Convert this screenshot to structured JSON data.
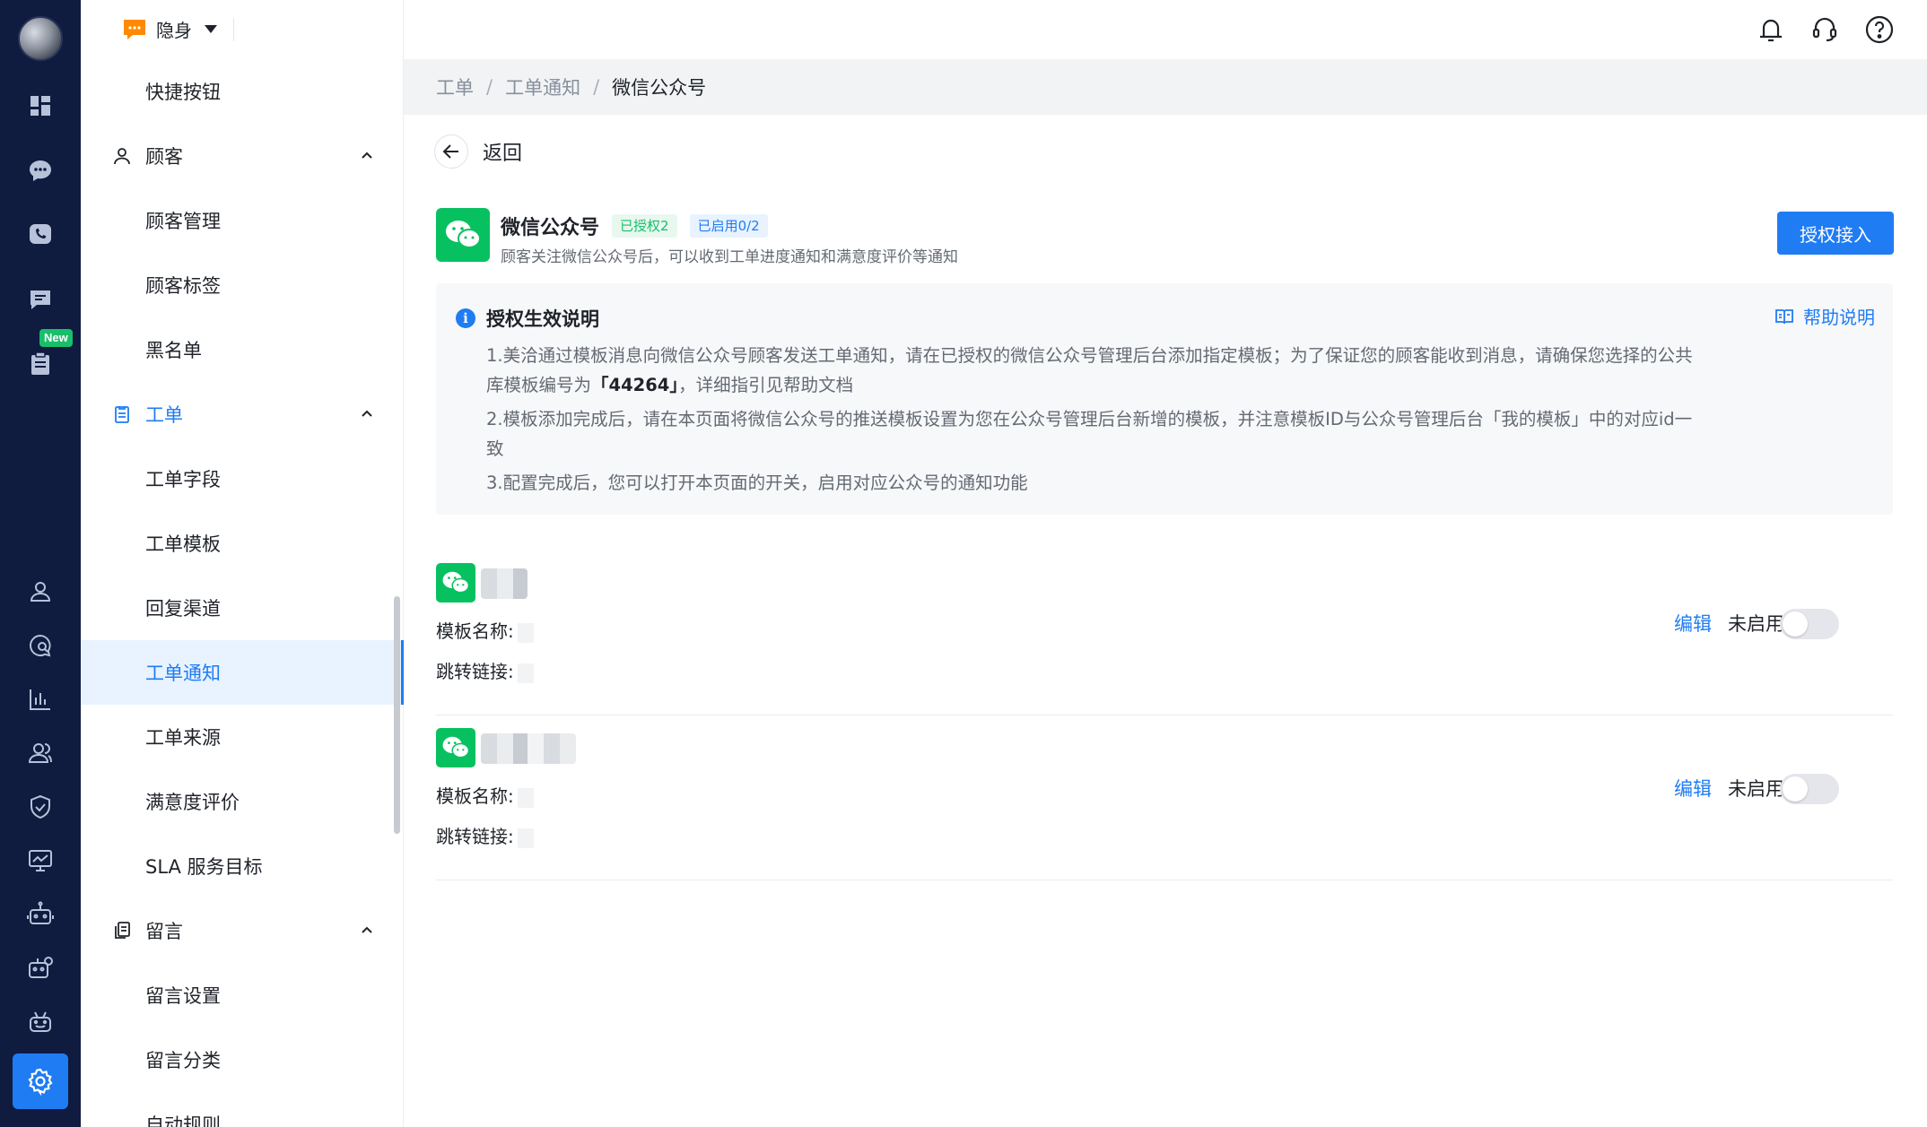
{
  "rail": {
    "new_badge": "New",
    "icons": [
      "dashboard-icon",
      "chat-icon",
      "phone-icon",
      "message-icon",
      "ticket-icon",
      "user-icon",
      "search-chat-icon",
      "chart-icon",
      "team-icon",
      "shield-icon",
      "monitor-icon",
      "robot-icon",
      "robot-settings-icon",
      "robot-face-icon",
      "gear-icon"
    ]
  },
  "status": {
    "label": "隐身"
  },
  "sidebar": {
    "items": [
      {
        "label": "快捷按钮",
        "type": "item"
      },
      {
        "label": "顾客",
        "type": "group"
      },
      {
        "label": "顾客管理",
        "type": "item"
      },
      {
        "label": "顾客标签",
        "type": "item"
      },
      {
        "label": "黑名单",
        "type": "item"
      },
      {
        "label": "工单",
        "type": "group"
      },
      {
        "label": "工单字段",
        "type": "item"
      },
      {
        "label": "工单模板",
        "type": "item"
      },
      {
        "label": "回复渠道",
        "type": "item"
      },
      {
        "label": "工单通知",
        "type": "item"
      },
      {
        "label": "工单来源",
        "type": "item"
      },
      {
        "label": "满意度评价",
        "type": "item"
      },
      {
        "label": "SLA 服务目标",
        "type": "item"
      },
      {
        "label": "留言",
        "type": "group"
      },
      {
        "label": "留言设置",
        "type": "item"
      },
      {
        "label": "留言分类",
        "type": "item"
      },
      {
        "label": "自动规则",
        "type": "item"
      }
    ]
  },
  "breadcrumb": [
    "工单",
    "工单通知",
    "微信公众号"
  ],
  "back_label": "返回",
  "app": {
    "title": "微信公众号",
    "tag_authorized": "已授权2",
    "tag_enabled": "已启用0/2",
    "desc": "顾客关注微信公众号后，可以收到工单进度通知和满意度评价等通知",
    "auth_button": "授权接入"
  },
  "notice": {
    "title": "授权生效说明",
    "help": "帮助说明",
    "line1_a": "1.美洽通过模板消息向微信公众号顾客发送工单通知，请在已授权的微信公众号管理后台添加指定模板；为了保证您的顾客能收到消息，请确保您选择的公共库模板编号为",
    "line1_code": "「44264」",
    "line1_b": "，详细指引见帮助文档",
    "line2": "2.模板添加完成后，请在本页面将微信公众号的推送模板设置为您在公众号管理后台新增的模板，并注意模板ID与公众号管理后台「我的模板」中的对应id一致",
    "line3": "3.配置完成后，您可以打开本页面的开关，启用对应公众号的通知功能"
  },
  "accounts": [
    {
      "template_label": "模板名称:",
      "link_label": "跳转链接:",
      "edit": "编辑",
      "state": "未启用"
    },
    {
      "template_label": "模板名称:",
      "link_label": "跳转链接:",
      "edit": "编辑",
      "state": "未启用"
    }
  ],
  "colors": {
    "primary": "#1f7cf3",
    "rail_bg": "#0f1b3f",
    "wechat_green": "#07c160"
  }
}
